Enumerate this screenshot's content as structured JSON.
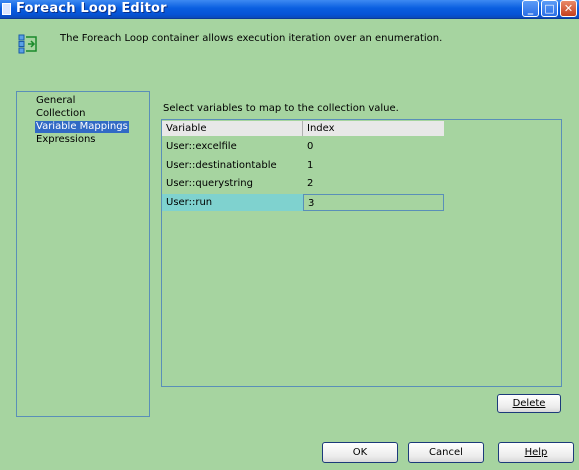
{
  "window": {
    "title": "Foreach Loop Editor"
  },
  "header": {
    "description": "The Foreach Loop container allows execution iteration over an enumeration."
  },
  "nav": {
    "items": [
      {
        "label": "General",
        "selected": false
      },
      {
        "label": "Collection",
        "selected": false
      },
      {
        "label": "Variable Mappings",
        "selected": true
      },
      {
        "label": "Expressions",
        "selected": false
      }
    ]
  },
  "main": {
    "prompt": "Select variables to map to the collection value.",
    "columns": [
      "Variable",
      "Index"
    ],
    "rows": [
      {
        "variable": "User::excelfile",
        "index": "0"
      },
      {
        "variable": "User::destinationtable",
        "index": "1"
      },
      {
        "variable": "User::querystring",
        "index": "2"
      },
      {
        "variable": "User::run",
        "index": "3"
      }
    ],
    "selected_row": 3
  },
  "buttons": {
    "delete": "Delete",
    "ok": "OK",
    "cancel": "Cancel",
    "help": "Help"
  },
  "colors": {
    "background": "#a6d4a0",
    "titlebar": "#0a5fe0",
    "selection": "#316ac5",
    "row_highlight": "#7fd2cf"
  }
}
